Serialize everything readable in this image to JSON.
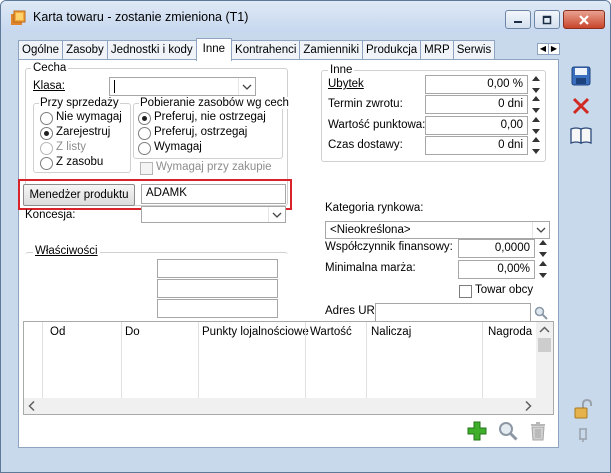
{
  "window": {
    "title": "Karta towaru - zostanie zmieniona (T1)"
  },
  "tabs": [
    "Ogólne",
    "Zasoby",
    "Jednostki i kody",
    "Inne",
    "Kontrahenci",
    "Zamienniki",
    "Produkcja",
    "MRP",
    "Serwis"
  ],
  "cecha": {
    "group_label": "Cecha",
    "klasa_label": "Klasa:",
    "klasa_value": ""
  },
  "przy_sprzedazy": {
    "group_label": "Przy sprzedaży",
    "options": [
      "Nie wymagaj",
      "Zarejestruj",
      "Z listy",
      "Z zasobu"
    ],
    "selected": "Zarejestruj"
  },
  "pobieranie": {
    "group_label": "Pobieranie zasobów wg cech",
    "options": [
      "Preferuj, nie ostrzegaj",
      "Preferuj, ostrzegaj",
      "Wymagaj"
    ],
    "selected": "Preferuj, nie ostrzegaj",
    "wymagaj_przy_zakupie": "Wymagaj przy zakupie"
  },
  "menedzer": {
    "button_label": "Menedżer produktu",
    "value": "ADAMK"
  },
  "koncesja": {
    "label": "Koncesja:",
    "value": ""
  },
  "wlasciwosci": {
    "label": "Właściwości"
  },
  "inne": {
    "group_label": "Inne",
    "ubytek_label": "Ubytek",
    "ubytek_value": "0,00 %",
    "termin_label": "Termin zwrotu:",
    "termin_value": "0 dni",
    "wartosc_label": "Wartość punktowa:",
    "wartosc_value": "0,00",
    "czas_label": "Czas dostawy:",
    "czas_value": "0 dni"
  },
  "kategoria": {
    "label": "Kategoria rynkowa:",
    "value": "<Nieokreślona>"
  },
  "wspolczynnik": {
    "label": "Współczynnik finansowy:",
    "value": "0,0000"
  },
  "marza": {
    "label": "Minimalna marża:",
    "value": "0,00%"
  },
  "towar_obcy": {
    "label": "Towar obcy"
  },
  "adres_url": {
    "label": "Adres URL:",
    "value": ""
  },
  "grid": {
    "columns": [
      "Od",
      "Do",
      "Punkty lojalnościowe",
      "Wartość",
      "Naliczaj",
      "Nagroda"
    ]
  },
  "colors": {
    "highlight": "#d9232b",
    "window_bg": "#c9d9ec"
  }
}
